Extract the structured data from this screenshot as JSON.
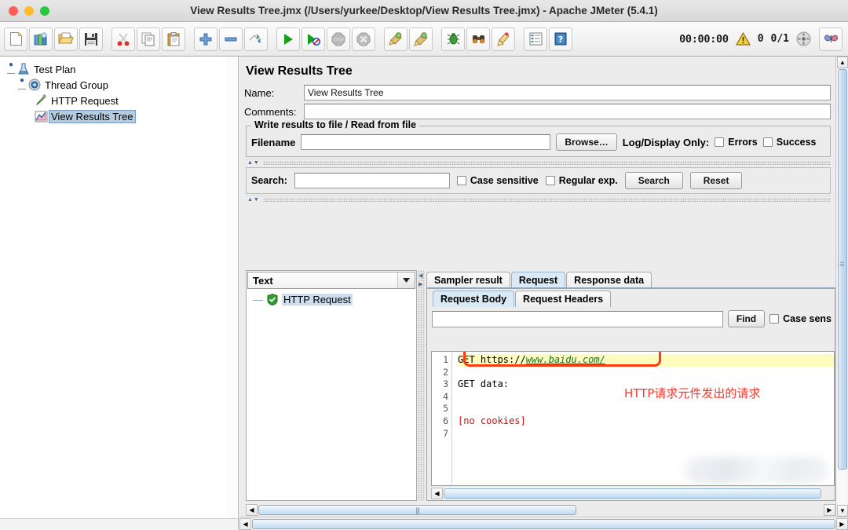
{
  "window": {
    "title": "View Results Tree.jmx (/Users/yurkee/Desktop/View Results Tree.jmx) - Apache JMeter (5.4.1)"
  },
  "toolbar": {
    "buttons": [
      {
        "name": "new-button",
        "icon": "new-document-icon",
        "glyph": "὜B"
      },
      {
        "name": "templates-button",
        "icon": "templates-icon",
        "glyph": "books"
      },
      {
        "name": "open-button",
        "icon": "open-folder-icon",
        "glyph": "folder"
      },
      {
        "name": "save-button",
        "icon": "save-disk-icon",
        "glyph": "floppy"
      },
      {
        "name": "cut-button",
        "icon": "scissors-icon",
        "glyph": "scissors"
      },
      {
        "name": "copy-button",
        "icon": "copy-icon",
        "glyph": "copy"
      },
      {
        "name": "paste-button",
        "icon": "clipboard-paste-icon",
        "glyph": "clipboard"
      },
      {
        "name": "expand-all-button",
        "icon": "plus-icon",
        "glyph": "plus"
      },
      {
        "name": "collapse-all-button",
        "icon": "minus-icon",
        "glyph": "minus"
      },
      {
        "name": "toggle-button",
        "icon": "toggle-icon",
        "glyph": "toggle"
      },
      {
        "name": "start-button",
        "icon": "play-icon",
        "glyph": "play"
      },
      {
        "name": "start-no-pauses-button",
        "icon": "play-no-pause-icon",
        "glyph": "play-no"
      },
      {
        "name": "stop-button",
        "icon": "stop-icon",
        "glyph": "stop"
      },
      {
        "name": "shutdown-button",
        "icon": "shutdown-icon",
        "glyph": "shutdown"
      },
      {
        "name": "clear-button",
        "icon": "broom-icon",
        "glyph": "broom"
      },
      {
        "name": "clear-all-button",
        "icon": "broom-all-icon",
        "glyph": "broom2"
      },
      {
        "name": "function-helper-button",
        "icon": "bug-icon",
        "glyph": "bug"
      },
      {
        "name": "search-button",
        "icon": "binoculars-icon",
        "glyph": "binocular"
      },
      {
        "name": "reset-search-button",
        "icon": "broom-reset-icon",
        "glyph": "broom3"
      },
      {
        "name": "log-viewer-button",
        "icon": "log-list-icon",
        "glyph": "loglist"
      },
      {
        "name": "help-button",
        "icon": "help-book-icon",
        "glyph": "help"
      }
    ],
    "elapsed_time": "00:00:00",
    "warning_count": "0",
    "thread_count": "0/1",
    "remote_icon": "remote-status-icon",
    "lab_icon": "butterfly-icon"
  },
  "tree": {
    "nodes": [
      {
        "label": "Test Plan",
        "icon": "test-plan-icon",
        "selected": false
      },
      {
        "label": "Thread Group",
        "icon": "thread-group-icon",
        "selected": false
      },
      {
        "label": "HTTP Request",
        "icon": "http-request-icon",
        "selected": false
      },
      {
        "label": "View Results Tree",
        "icon": "view-results-tree-icon",
        "selected": true
      }
    ]
  },
  "panel": {
    "title": "View Results Tree",
    "name_label": "Name:",
    "name_value": "View Results Tree",
    "comments_label": "Comments:",
    "comments_value": "",
    "fileset": {
      "legend": "Write results to file / Read from file",
      "filename_label": "Filename",
      "filename_value": "",
      "browse_label": "Browse…",
      "logdisplay_label": "Log/Display Only:",
      "errors_label": "Errors",
      "success_label": "Success"
    },
    "search": {
      "label": "Search:",
      "value": "",
      "case_sensitive_label": "Case sensitive",
      "regular_exp_label": "Regular exp.",
      "search_button": "Search",
      "reset_button": "Reset"
    }
  },
  "results": {
    "render_selected": "Text",
    "items": [
      {
        "label": "HTTP Request",
        "status": "success",
        "icon": "success-shield-icon"
      }
    ]
  },
  "tabs": {
    "main": [
      {
        "label": "Sampler result",
        "selected": false
      },
      {
        "label": "Request",
        "selected": true
      },
      {
        "label": "Response data",
        "selected": false
      }
    ],
    "sub": [
      {
        "label": "Request Body",
        "selected": true
      },
      {
        "label": "Request Headers",
        "selected": false
      }
    ]
  },
  "find": {
    "value": "",
    "find_button": "Find",
    "case_sensitive_label": "Case sens"
  },
  "code": {
    "line_numbers": [
      "1",
      "2",
      "3",
      "4",
      "5",
      "6",
      "7"
    ],
    "lines": [
      {
        "prefix": "GET https://",
        "link": "www.baidu.com/",
        "highlight": true
      },
      {
        "prefix": "",
        "link": "",
        "highlight": false
      },
      {
        "prefix": "GET data:",
        "link": "",
        "highlight": false
      },
      {
        "prefix": "",
        "link": "",
        "highlight": false
      },
      {
        "prefix": "",
        "link": "",
        "highlight": false
      },
      {
        "prefix": "[no cookies]",
        "link": "",
        "highlight": false,
        "red": true
      },
      {
        "prefix": "",
        "link": "",
        "highlight": false
      }
    ]
  },
  "annotation": {
    "text": "HTTP请求元件发出的请求",
    "color": "#f1392b",
    "box_color": "#fa3c14"
  },
  "colors": {
    "selection": "#b5cce0",
    "tab_selected": "#d9e9f5",
    "highlight": "#fdfbbd",
    "link": "#0a7a27",
    "error": "#d01010"
  }
}
